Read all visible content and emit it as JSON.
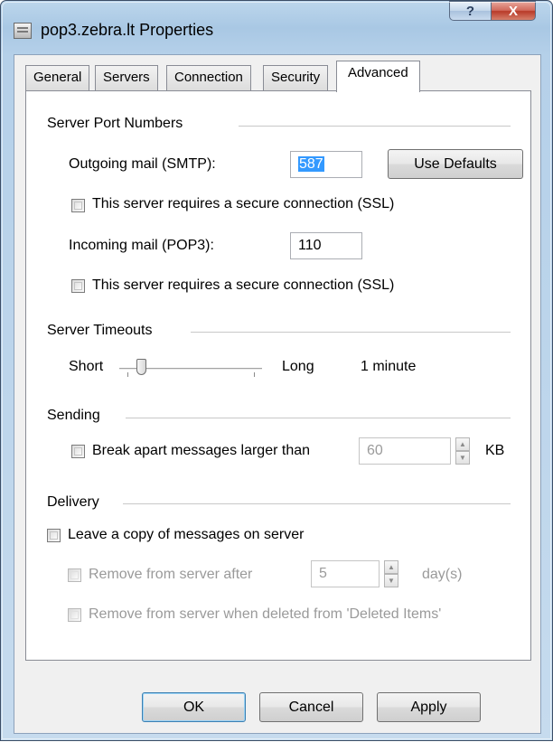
{
  "window": {
    "title": "pop3.zebra.lt Properties",
    "help_glyph": "?",
    "close_glyph": "X"
  },
  "tabs": [
    {
      "label": "General",
      "active": false
    },
    {
      "label": "Servers",
      "active": false
    },
    {
      "label": "Connection",
      "active": false
    },
    {
      "label": "Security",
      "active": false
    },
    {
      "label": "Advanced",
      "active": true
    }
  ],
  "server_ports": {
    "heading": "Server Port Numbers",
    "outgoing_label": "Outgoing mail (SMTP):",
    "outgoing_value": "587",
    "use_defaults_label": "Use Defaults",
    "outgoing_ssl_label": "This server requires a secure connection (SSL)",
    "outgoing_ssl_checked": false,
    "incoming_label": "Incoming mail (POP3):",
    "incoming_value": "110",
    "incoming_ssl_label": "This server requires a secure connection (SSL)",
    "incoming_ssl_checked": false
  },
  "timeouts": {
    "heading": "Server Timeouts",
    "short_label": "Short",
    "long_label": "Long",
    "value_text": "1 minute",
    "slider_level": 0.15
  },
  "sending": {
    "heading": "Sending",
    "break_apart_label": "Break apart messages larger than",
    "break_apart_checked": false,
    "size_value": "60",
    "size_unit": "KB"
  },
  "delivery": {
    "heading": "Delivery",
    "leave_copy_label": "Leave a copy of messages on server",
    "leave_copy_checked": false,
    "remove_after_label": "Remove from server after",
    "remove_after_value": "5",
    "remove_after_unit": "day(s)",
    "remove_deleted_label": "Remove from server when deleted from 'Deleted Items'"
  },
  "buttons": {
    "ok": "OK",
    "cancel": "Cancel",
    "apply": "Apply"
  },
  "colors": {
    "selection": "#3399ff",
    "close_button": "#c4402e",
    "title_bar": "#a9c8e4"
  },
  "icons": {
    "title_icon": "server-properties-icon",
    "spin_up": "spin-up-arrow-icon",
    "spin_down": "spin-down-arrow-icon"
  }
}
